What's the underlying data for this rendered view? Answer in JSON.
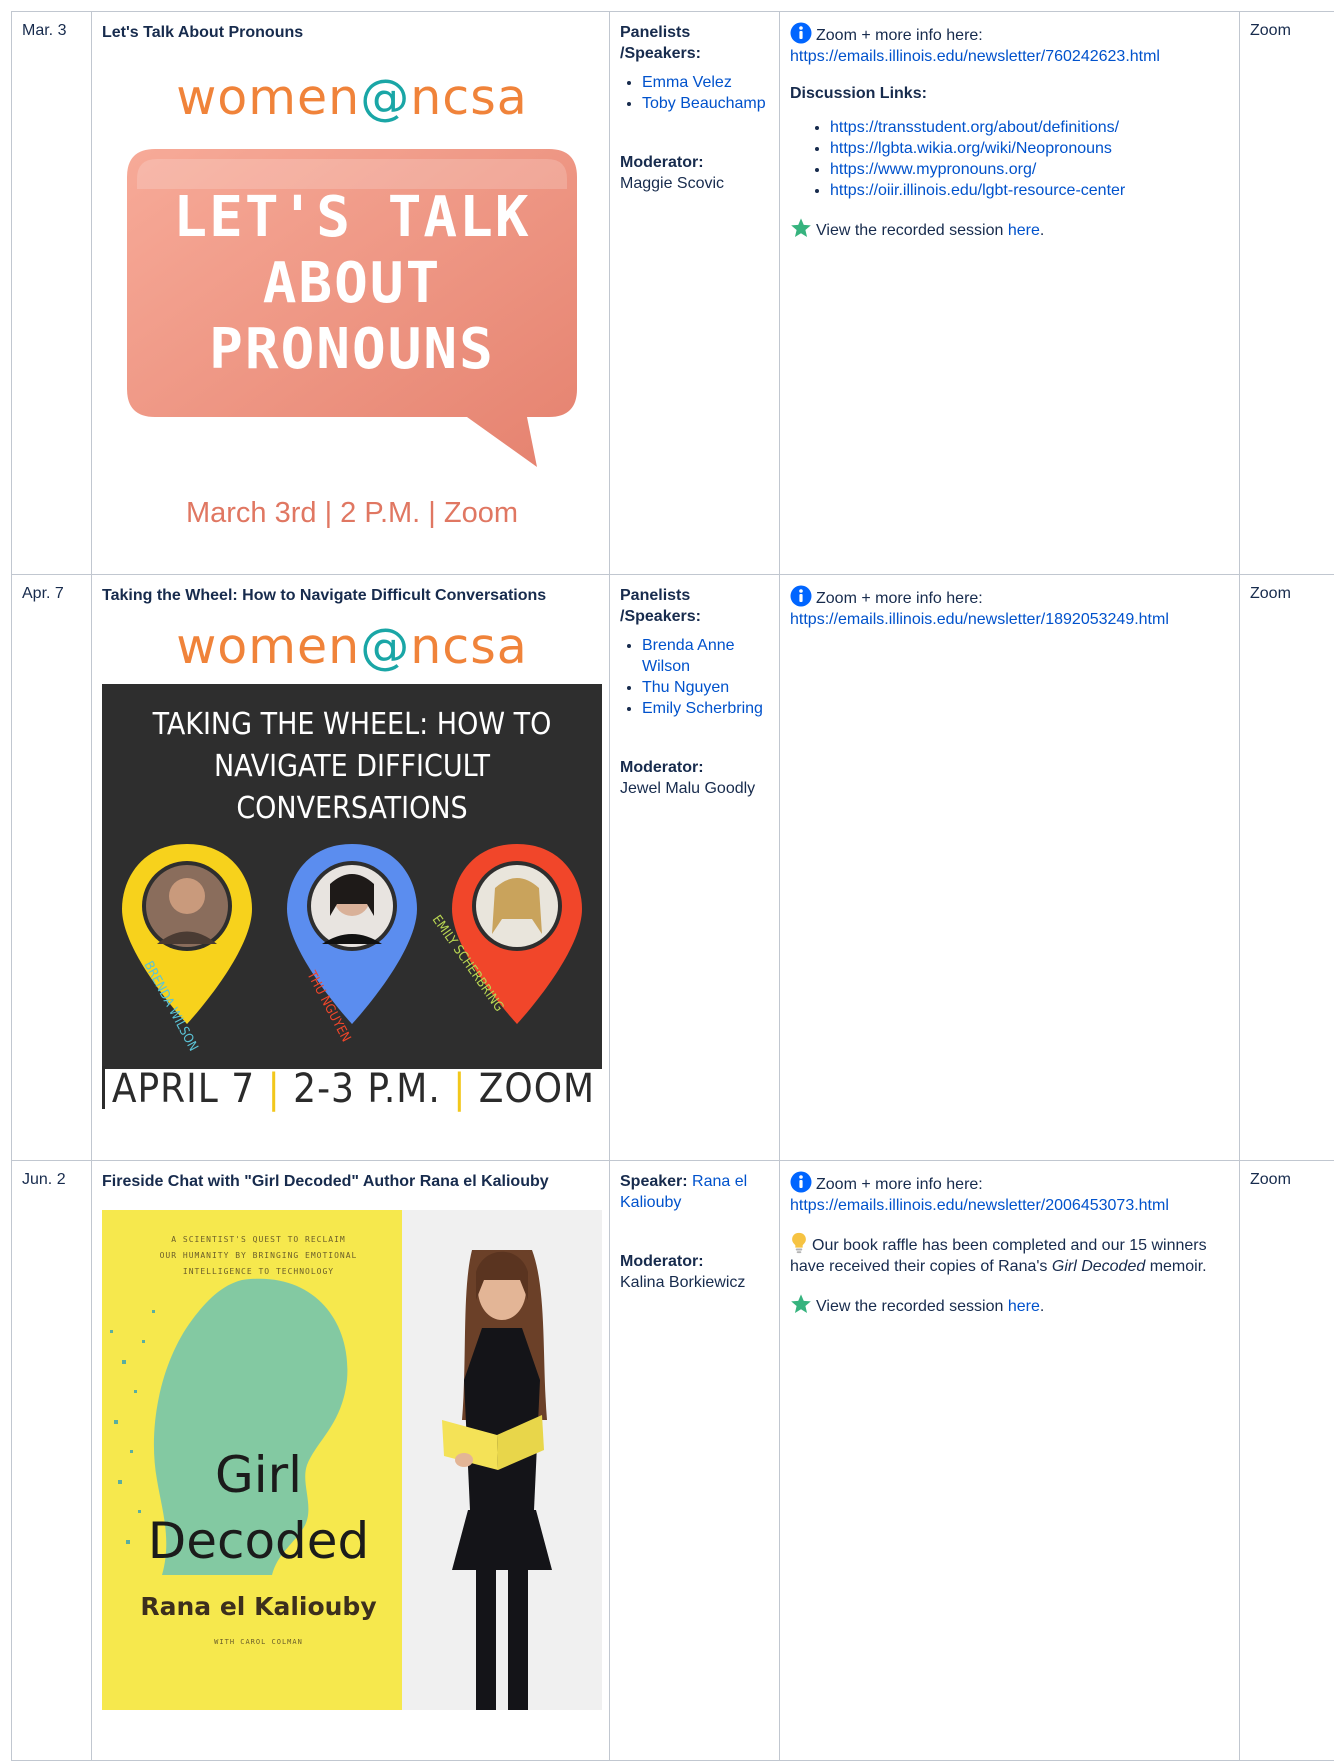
{
  "rows": [
    {
      "date": "Mar. 3",
      "title": "Let's Talk About Pronouns",
      "poster": {
        "wordmark_a": "women",
        "wordmark_at": "@",
        "wordmark_b": "ncsa",
        "bubble_line1": "LET'S TALK",
        "bubble_line2": "ABOUT",
        "bubble_line3": "PRONOUNS",
        "footer": "March 3rd | 2 P.M. | Zoom"
      },
      "people_label": "Panelists /Speakers:",
      "people": [
        "Emma Velez",
        "Toby Beauchamp"
      ],
      "moderator_label": "Moderator:",
      "moderator": "Maggie Scovic",
      "info_prefix": "Zoom + more info here:",
      "info_link": "https://emails.illinois.edu/newsletter/760242623.html",
      "discussion_title": "Discussion Links:",
      "discussion_links": [
        "https://transstudent.org/about/definitions/",
        "https://lgbta.wikia.org/wiki/Neopronouns",
        "https://www.mypronouns.org/",
        "https://oiir.illinois.edu/lgbt-resource-center"
      ],
      "recorded_prefix": "View the recorded session",
      "recorded_link": "here",
      "recorded_suffix": ".",
      "location": "Zoom"
    },
    {
      "date": "Apr. 7",
      "title": "Taking the Wheel: How to Navigate Difficult Conversations",
      "poster": {
        "wordmark_a": "women",
        "wordmark_at": "@",
        "wordmark_b": "ncsa",
        "headline_line1": "TAKING THE WHEEL: HOW TO",
        "headline_line2": "NAVIGATE DIFFICULT CONVERSATIONS",
        "pin_names": [
          "BRENDA WILSON",
          "THU NGUYEN",
          "EMILY SCHERBRING"
        ],
        "footer_a": "APRIL 7",
        "footer_sep": "|",
        "footer_b": "2-3 P.M.",
        "footer_c": "ZOOM"
      },
      "people_label": "Panelists /Speakers:",
      "people": [
        "Brenda Anne Wilson",
        "Thu Nguyen",
        "Emily Scherbring"
      ],
      "moderator_label": "Moderator:",
      "moderator": "Jewel Malu Goodly",
      "info_prefix": "Zoom + more info here:",
      "info_link": "https://emails.illinois.edu/newsletter/1892053249.html",
      "location": "Zoom"
    },
    {
      "date": "Jun. 2",
      "title": "Fireside Chat with \"Girl Decoded\" Author Rana el Kaliouby",
      "poster": {
        "cover_tagline_1": "A SCIENTIST'S QUEST TO RECLAIM",
        "cover_tagline_2": "OUR HUMANITY BY BRINGING EMOTIONAL",
        "cover_tagline_3": "INTELLIGENCE TO TECHNOLOGY",
        "book_title_1": "Girl",
        "book_title_2": "Decoded",
        "book_author": "Rana el Kaliouby",
        "book_with": "WITH CAROL COLMAN"
      },
      "speaker_label": "Speaker:",
      "speaker": "Rana el Kaliouby",
      "moderator_label": "Moderator:",
      "moderator": "Kalina Borkiewicz",
      "info_prefix": "Zoom + more info here:",
      "info_link": "https://emails.illinois.edu/newsletter/2006453073.html",
      "raffle_a": "Our book raffle has been completed and our 15 winners have received their copies of Rana's",
      "raffle_em": "Girl Decoded",
      "raffle_b": "memoir.",
      "recorded_prefix": "View the recorded session",
      "recorded_link": "here",
      "recorded_suffix": ".",
      "location": "Zoom"
    }
  ],
  "colors": {
    "link": "#0052cc",
    "border": "#c1c7d0",
    "info_icon": "#0065ff",
    "star_icon": "#36b37e",
    "bulb_icon": "#f6c342",
    "brand_orange": "#f0833a",
    "bubble_salmon": "#f29c8a"
  },
  "icons": [
    "info-icon",
    "star-icon",
    "lightbulb-icon"
  ]
}
